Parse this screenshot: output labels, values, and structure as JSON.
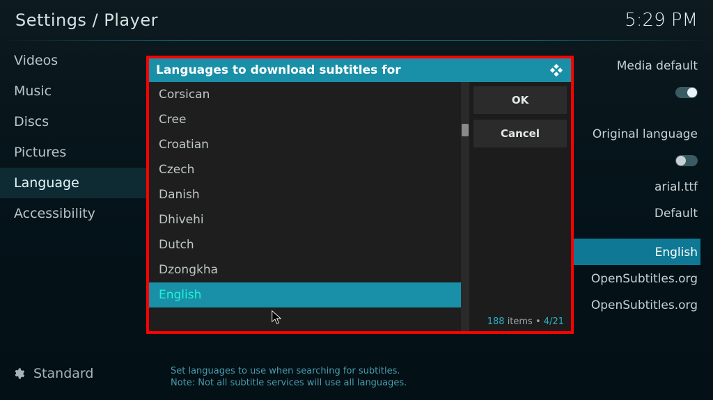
{
  "header": {
    "title": "Settings / Player",
    "clock": "5:29 PM"
  },
  "sidebar": {
    "items": [
      {
        "label": "Videos"
      },
      {
        "label": "Music"
      },
      {
        "label": "Discs"
      },
      {
        "label": "Pictures"
      },
      {
        "label": "Language",
        "selected": true
      },
      {
        "label": "Accessibility"
      }
    ],
    "level": "Standard"
  },
  "right_settings": {
    "rows": [
      {
        "label": "Media default"
      },
      {
        "toggle": "on"
      },
      {
        "label": "Original language"
      },
      {
        "toggle": "off"
      },
      {
        "label": "arial.ttf"
      },
      {
        "label": "Default"
      },
      {
        "spacer": true
      },
      {
        "label": "English",
        "highlight": true
      },
      {
        "label": "OpenSubtitles.org"
      },
      {
        "label": "OpenSubtitles.org"
      }
    ]
  },
  "help": {
    "line1": "Set languages to use when searching for subtitles.",
    "line2": "Note: Not all subtitle services will use all languages."
  },
  "dialog": {
    "title": "Languages to download subtitles for",
    "items": [
      "Corsican",
      "Cree",
      "Croatian",
      "Czech",
      "Danish",
      "Dhivehi",
      "Dutch",
      "Dzongkha",
      "English"
    ],
    "selected_index": 8,
    "buttons": {
      "ok": "OK",
      "cancel": "Cancel"
    },
    "count": {
      "num": "188",
      "items_word": "items",
      "page": "4/21"
    }
  }
}
